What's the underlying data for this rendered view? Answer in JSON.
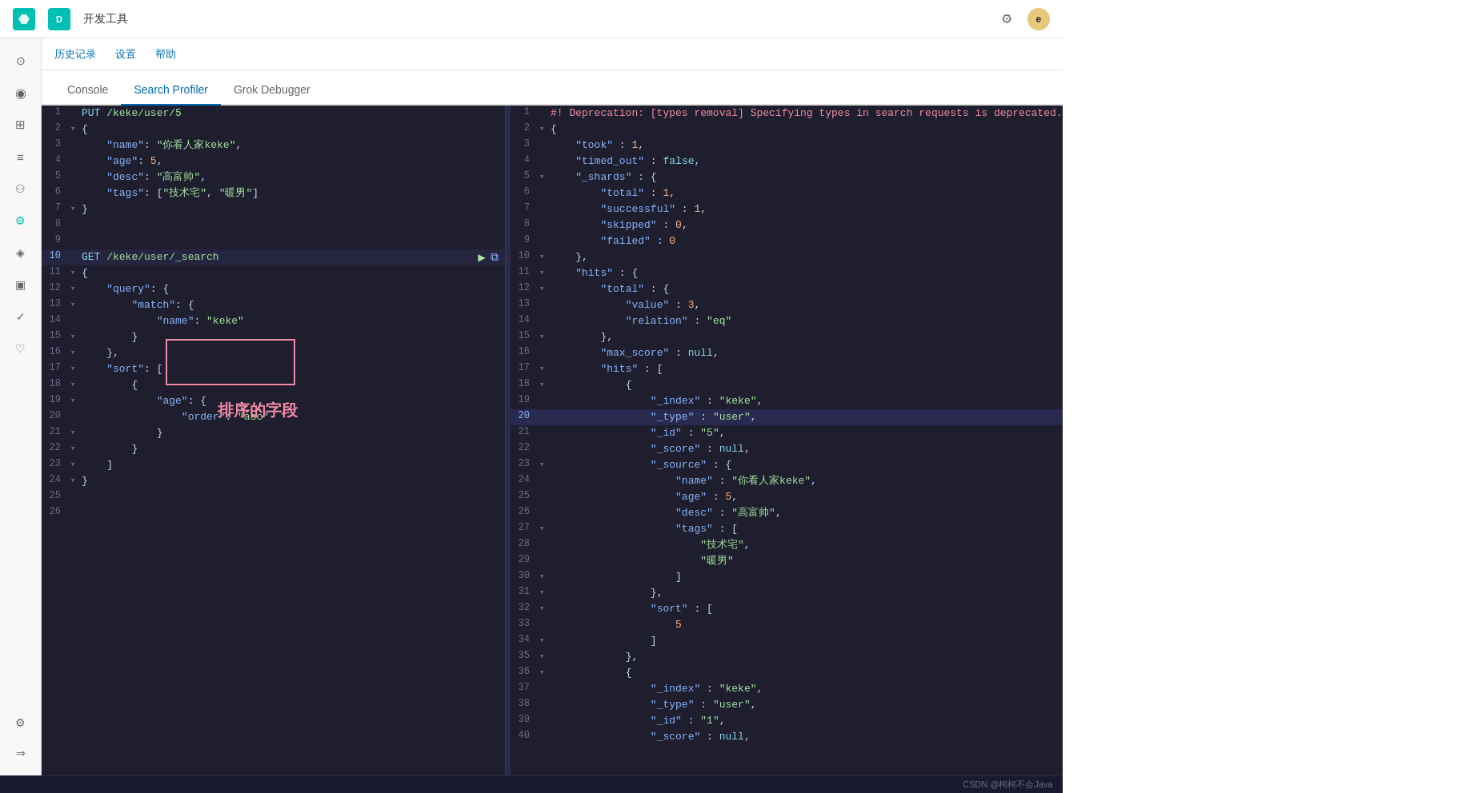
{
  "topbar": {
    "brand_letter": "D",
    "title": "开发工具",
    "settings_icon": "⚙",
    "user_letter": "e"
  },
  "secondary_nav": {
    "items": [
      "历史记录",
      "设置",
      "帮助"
    ]
  },
  "tabs": [
    {
      "label": "Console",
      "active": false
    },
    {
      "label": "Search Profiler",
      "active": true
    },
    {
      "label": "Grok Debugger",
      "active": false
    }
  ],
  "sidebar_icons": [
    {
      "icon": "○",
      "name": "recent"
    },
    {
      "icon": "◎",
      "name": "discover"
    },
    {
      "icon": "▦",
      "name": "dashboard"
    },
    {
      "icon": "≋",
      "name": "visualize"
    },
    {
      "icon": "♦",
      "name": "apm"
    },
    {
      "icon": "◈",
      "name": "dev-tools",
      "active": true
    },
    {
      "icon": "✉",
      "name": "ml"
    },
    {
      "icon": "◰",
      "name": "infrastructure"
    },
    {
      "icon": "✓",
      "name": "uptime"
    },
    {
      "icon": "♡",
      "name": "maps"
    },
    {
      "icon": "⚙",
      "name": "settings"
    }
  ],
  "editor": {
    "lines": [
      {
        "num": 1,
        "fold": "",
        "content": "PUT /keke/user/5",
        "method": "PUT",
        "url": "/keke/user/5"
      },
      {
        "num": 2,
        "fold": "-",
        "content": "{"
      },
      {
        "num": 3,
        "fold": "",
        "content": "    \"name\": \"你看人家keke\","
      },
      {
        "num": 4,
        "fold": "",
        "content": "    \"age\": 5,"
      },
      {
        "num": 5,
        "fold": "",
        "content": "    \"desc\": \"高富帅\","
      },
      {
        "num": 6,
        "fold": "",
        "content": "    \"tags\": [\"技术宅\", \"暖男\"]"
      },
      {
        "num": 7,
        "fold": "-",
        "content": "}"
      },
      {
        "num": 8,
        "fold": "",
        "content": ""
      },
      {
        "num": 9,
        "fold": "",
        "content": ""
      },
      {
        "num": 10,
        "fold": "",
        "content": "GET /keke/user/_search",
        "method": "GET",
        "url": "/keke/user/_search",
        "has_actions": true
      },
      {
        "num": 11,
        "fold": "-",
        "content": "{"
      },
      {
        "num": 12,
        "fold": "-",
        "content": "    \"query\": {"
      },
      {
        "num": 13,
        "fold": "-",
        "content": "        \"match\": {"
      },
      {
        "num": 14,
        "fold": "",
        "content": "            \"name\": \"keke\""
      },
      {
        "num": 15,
        "fold": "-",
        "content": "        }"
      },
      {
        "num": 16,
        "fold": "-",
        "content": "    },"
      },
      {
        "num": 17,
        "fold": "-",
        "content": "    \"sort\": ["
      },
      {
        "num": 18,
        "fold": "-",
        "content": "        {"
      },
      {
        "num": 19,
        "fold": "-",
        "content": "            \"age\": {"
      },
      {
        "num": 20,
        "fold": "",
        "content": "                \"order\": \"asc\""
      },
      {
        "num": 21,
        "fold": "-",
        "content": "            }"
      },
      {
        "num": 22,
        "fold": "-",
        "content": "        }"
      },
      {
        "num": 23,
        "fold": "-",
        "content": "    ]"
      },
      {
        "num": 24,
        "fold": "-",
        "content": "}"
      },
      {
        "num": 25,
        "fold": "",
        "content": ""
      },
      {
        "num": 26,
        "fold": "",
        "content": ""
      }
    ]
  },
  "output": {
    "lines": [
      {
        "num": 1,
        "content": "#! Deprecation: [types removal] Specifying types in search requests is deprecated.",
        "type": "comment"
      },
      {
        "num": 2,
        "content": "{",
        "type": "punct"
      },
      {
        "num": 3,
        "content": "    \"took\" : 1,"
      },
      {
        "num": 4,
        "content": "    \"timed_out\" : false,"
      },
      {
        "num": 5,
        "content": "    \"_shards\" : {"
      },
      {
        "num": 6,
        "content": "        \"total\" : 1,"
      },
      {
        "num": 7,
        "content": "        \"successful\" : 1,"
      },
      {
        "num": 8,
        "content": "        \"skipped\" : 0,"
      },
      {
        "num": 9,
        "content": "        \"failed\" : 0"
      },
      {
        "num": 10,
        "content": "    },"
      },
      {
        "num": 11,
        "content": "    \"hits\" : {"
      },
      {
        "num": 12,
        "content": "        \"total\" : {"
      },
      {
        "num": 13,
        "content": "            \"value\" : 3,"
      },
      {
        "num": 14,
        "content": "            \"relation\" : \"eq\""
      },
      {
        "num": 15,
        "content": "        },"
      },
      {
        "num": 16,
        "content": "        \"max_score\" : null,"
      },
      {
        "num": 17,
        "content": "        \"hits\" : ["
      },
      {
        "num": 18,
        "content": "            {"
      },
      {
        "num": 19,
        "content": "                \"_index\" : \"keke\","
      },
      {
        "num": 20,
        "content": "                \"_type\" : \"user\",",
        "highlight": true
      },
      {
        "num": 21,
        "content": "                \"_id\" : \"5\","
      },
      {
        "num": 22,
        "content": "                \"_score\" : null,"
      },
      {
        "num": 23,
        "content": "                \"_source\" : {"
      },
      {
        "num": 24,
        "content": "                    \"name\" : \"你看人家keke\","
      },
      {
        "num": 25,
        "content": "                    \"age\" : 5,"
      },
      {
        "num": 26,
        "content": "                    \"desc\" : \"高富帅\","
      },
      {
        "num": 27,
        "content": "                    \"tags\" : ["
      },
      {
        "num": 28,
        "content": "                        \"技术宅\","
      },
      {
        "num": 29,
        "content": "                        \"暖男\""
      },
      {
        "num": 30,
        "content": "                    ]"
      },
      {
        "num": 31,
        "content": "                },"
      },
      {
        "num": 32,
        "content": "                \"sort\" : ["
      },
      {
        "num": 33,
        "content": "                    5"
      },
      {
        "num": 34,
        "content": "                ]"
      },
      {
        "num": 35,
        "content": "            },"
      },
      {
        "num": 36,
        "content": "            {"
      },
      {
        "num": 37,
        "content": "                \"_index\" : \"keke\","
      },
      {
        "num": 38,
        "content": "                \"_type\" : \"user\","
      },
      {
        "num": 39,
        "content": "                \"_id\" : \"1\","
      },
      {
        "num": 40,
        "content": "                \"_score\" : null,"
      }
    ]
  },
  "annotation": {
    "label": "排序的字段"
  },
  "status_bar": {
    "text": "CSDN @柯柯不会Java"
  }
}
